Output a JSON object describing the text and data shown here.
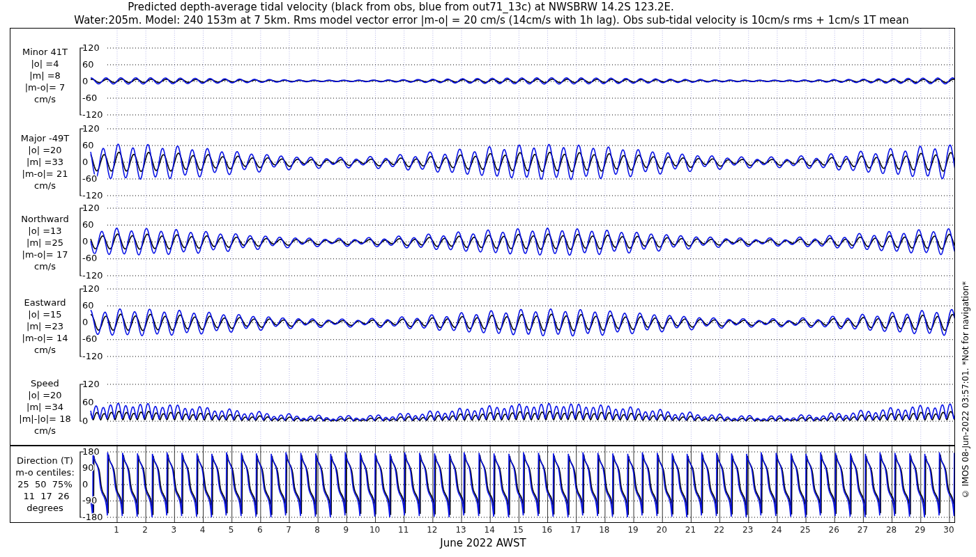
{
  "title": {
    "lines": [
      "Predicted depth-average tidal velocity (black from obs, blue from out71_13c) at NWSBRW 14.2S 123.2E.",
      "Water:205m. Model: 240 153m at 7 5km. Rms model vector error |m-o| = 20 cm/s (14cm/s with 1h lag). Obs sub-tidal velocity is 10cm/s rms + 1cm/s 1T mean"
    ]
  },
  "upper_panels": [
    {
      "kind": "minor",
      "label": [
        "Minor 41T",
        "|o| =4",
        "|m| =8",
        "|m-o|= 7",
        "cm/s"
      ],
      "yticks": [
        "120",
        "60",
        "0",
        "-60",
        "-120"
      ]
    },
    {
      "kind": "major",
      "label": [
        "Major -49T",
        "|o| =20",
        "|m| =33",
        "|m-o|= 21",
        "cm/s"
      ],
      "yticks": [
        "120",
        "60",
        "0",
        "-60",
        "-120"
      ]
    },
    {
      "kind": "north",
      "label": [
        "Northward",
        "|o| =13",
        "|m| =25",
        "|m-o|= 17",
        "cm/s"
      ],
      "yticks": [
        "120",
        "60",
        "0",
        "-60",
        "-120"
      ]
    },
    {
      "kind": "east",
      "label": [
        "Eastward",
        "|o| =15",
        "|m| =23",
        "|m-o|= 14",
        "cm/s"
      ],
      "yticks": [
        "120",
        "60",
        "0",
        "-60",
        "-120"
      ]
    },
    {
      "kind": "speed",
      "label": [
        "Speed",
        "|o| =20",
        "|m| =34",
        "|m|-|o|= 18",
        "cm/s"
      ],
      "yticks": [
        "120",
        "60",
        "0"
      ]
    }
  ],
  "lower_panel": {
    "kind": "direction",
    "label": [
      "Direction (T)",
      "m-o centiles:",
      "25  50  75%",
      " 11  17  26",
      "degrees"
    ],
    "yticks": [
      "180",
      "90",
      "0",
      "-90",
      "-180"
    ]
  },
  "x_axis": {
    "ticks": [
      "1",
      "2",
      "3",
      "4",
      "5",
      "6",
      "7",
      "8",
      "9",
      "10",
      "11",
      "12",
      "13",
      "14",
      "15",
      "16",
      "17",
      "18",
      "19",
      "20",
      "21",
      "22",
      "23",
      "24",
      "25",
      "26",
      "27",
      "28",
      "29",
      "30"
    ],
    "label": "June 2022 AWST"
  },
  "side_note": "© IMOS 08-Jun-2022 03:57:01. *Not for navigation*"
}
